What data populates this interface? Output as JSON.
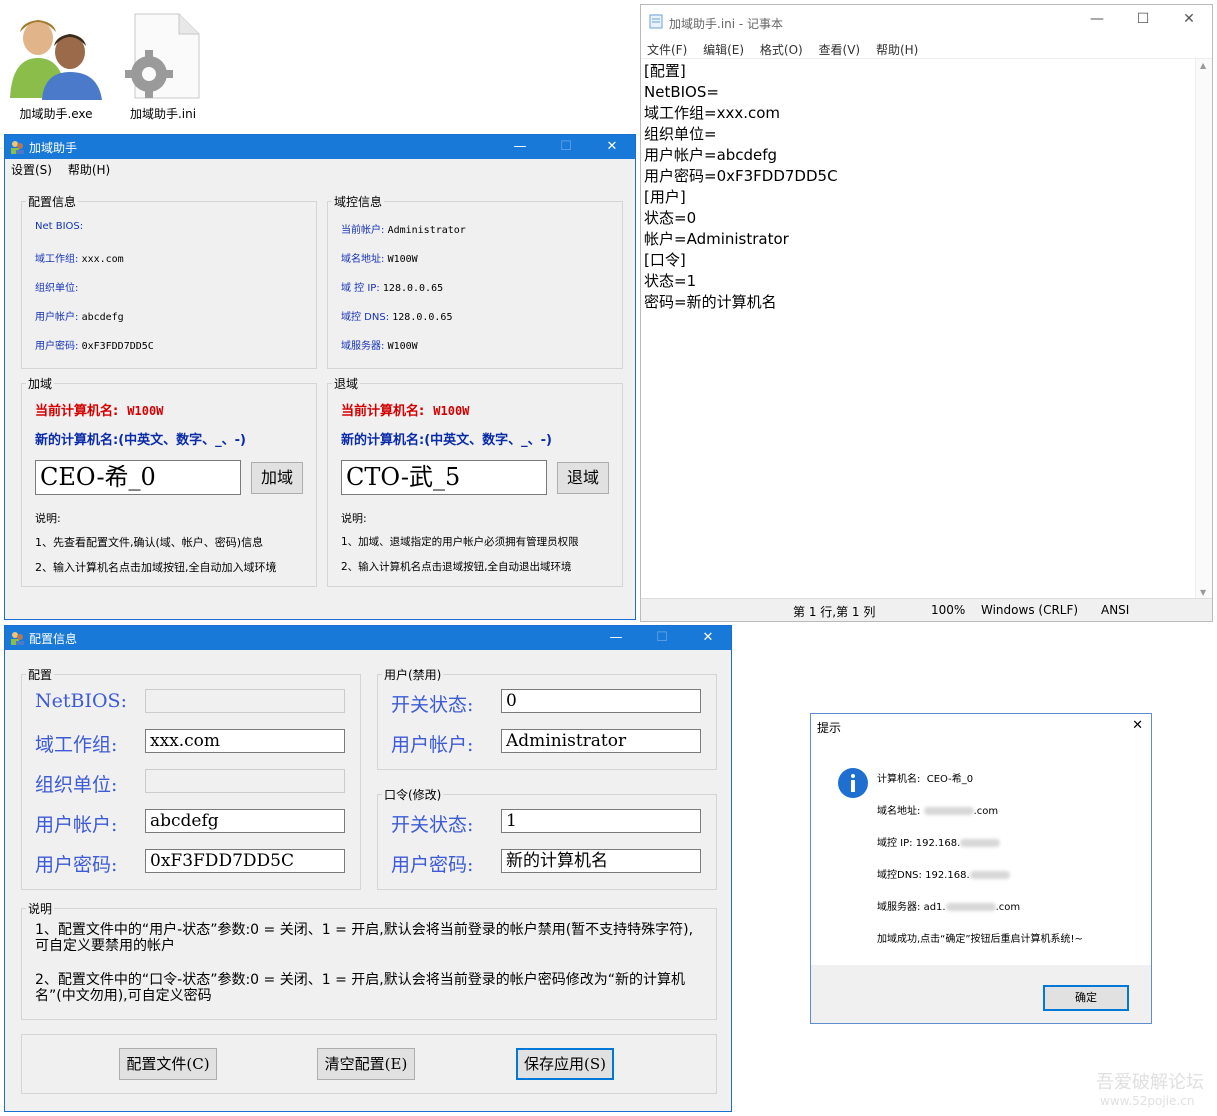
{
  "desktop": {
    "icons": [
      {
        "label": "加域助手.exe",
        "icon": "users-icon"
      },
      {
        "label": "加域助手.ini",
        "icon": "gear-file-icon"
      }
    ]
  },
  "main_window": {
    "title": "加域助手",
    "controls": {
      "minimize": "—",
      "maximize": "☐",
      "close": "✕"
    },
    "menu": [
      "设置(S)",
      "帮助(H)"
    ],
    "config_group": {
      "legend": "配置信息",
      "rows": [
        {
          "label": "Net BIOS:",
          "value": ""
        },
        {
          "label": "域工作组:",
          "value": "xxx.com"
        },
        {
          "label": "组织单位:",
          "value": ""
        },
        {
          "label": "用户帐户:",
          "value": "abcdefg"
        },
        {
          "label": "用户密码:",
          "value": "0xF3FDD7DD5C"
        }
      ]
    },
    "dc_group": {
      "legend": "域控信息",
      "rows": [
        {
          "label": "当前帐户:",
          "value": "Administrator"
        },
        {
          "label": "域名地址:",
          "value": "W100W"
        },
        {
          "label": "域 控 IP:",
          "value": "128.0.0.65"
        },
        {
          "label": "域控 DNS:",
          "value": "128.0.0.65"
        },
        {
          "label": "域服务器:",
          "value": "W100W"
        }
      ]
    },
    "join_group": {
      "legend": "加域",
      "current_label": "当前计算机名:",
      "current_value": "W100W",
      "new_label": "新的计算机名:(中英文、数字、_、-)",
      "input_value": "CEO-希_0",
      "button": "加域",
      "note_title": "说明:",
      "notes": [
        "1、先查看配置文件,确认(域、帐户、密码)信息",
        "2、输入计算机名点击加域按钮,全自动加入域环境"
      ]
    },
    "leave_group": {
      "legend": "退域",
      "current_label": "当前计算机名:",
      "current_value": "W100W",
      "new_label": "新的计算机名:(中英文、数字、_、-)",
      "input_value": "CTO-武_5",
      "button": "退域",
      "note_title": "说明:",
      "notes": [
        "1、加域、退域指定的用户帐户必须拥有管理员权限",
        "2、输入计算机名点击退域按钮,全自动退出域环境"
      ]
    }
  },
  "config_window": {
    "title": "配置信息",
    "controls": {
      "minimize": "—",
      "maximize": "☐",
      "close": "✕"
    },
    "config_group": {
      "legend": "配置",
      "rows": [
        {
          "label": "NetBIOS:",
          "value": ""
        },
        {
          "label": "域工作组:",
          "value": "xxx.com"
        },
        {
          "label": "组织单位:",
          "value": ""
        },
        {
          "label": "用户帐户:",
          "value": "abcdefg"
        },
        {
          "label": "用户密码:",
          "value": "0xF3FDD7DD5C"
        }
      ]
    },
    "user_group": {
      "legend": "用户(禁用)",
      "rows": [
        {
          "label": "开关状态:",
          "value": "0"
        },
        {
          "label": "用户帐户:",
          "value": "Administrator"
        }
      ]
    },
    "pwd_group": {
      "legend": "口令(修改)",
      "rows": [
        {
          "label": "开关状态:",
          "value": "1"
        },
        {
          "label": "用户密码:",
          "value": "新的计算机名"
        }
      ]
    },
    "notes_group": {
      "legend": "说明",
      "notes": [
        "1、配置文件中的“用户-状态”参数:0 = 关闭、1 = 开启,默认会将当前登录的帐户禁用(暂不支持特殊字符),可自定义要禁用的帐户",
        "2、配置文件中的“口令-状态”参数:0 = 关闭、1 = 开启,默认会将当前登录的帐户密码修改为“新的计算机名”(中文勿用),可自定义密码"
      ]
    },
    "buttons": [
      "配置文件(C)",
      "清空配置(E)",
      "保存应用(S)"
    ]
  },
  "notepad": {
    "title": "加域助手.ini - 记事本",
    "controls": {
      "minimize": "—",
      "maximize": "☐",
      "close": "✕"
    },
    "menu": [
      "文件(F)",
      "编辑(E)",
      "格式(O)",
      "查看(V)",
      "帮助(H)"
    ],
    "lines": [
      "[配置]",
      "NetBIOS=",
      "域工作组=xxx.com",
      "组织单位=",
      "用户帐户=abcdefg",
      "用户密码=0xF3FDD7DD5C",
      "[用户]",
      "状态=0",
      "帐户=Administrator",
      "[口令]",
      "状态=1",
      "密码=新的计算机名"
    ],
    "status": {
      "position": "第 1 行,第 1 列",
      "zoom": "100%",
      "eol": "Windows (CRLF)",
      "encoding": "ANSI"
    }
  },
  "dialog": {
    "title": "提示",
    "close": "✕",
    "icon": "info-icon",
    "rows": [
      {
        "label": "计算机名:",
        "value": "CEO-希_0"
      },
      {
        "label": "域名地址:",
        "value": ".com"
      },
      {
        "label": "域控 IP:",
        "value": "192.168."
      },
      {
        "label": "域控DNS:",
        "value": "192.168."
      },
      {
        "label": "域服务器:",
        "value": "ad1."
      },
      {
        "label": "",
        "value": "加域成功,点击“确定”按钮后重启计算机系统!~"
      }
    ],
    "ok_button": "确定"
  },
  "watermark": {
    "line1": "吾爱破解论坛",
    "line2": "www.52pojie.cn"
  }
}
